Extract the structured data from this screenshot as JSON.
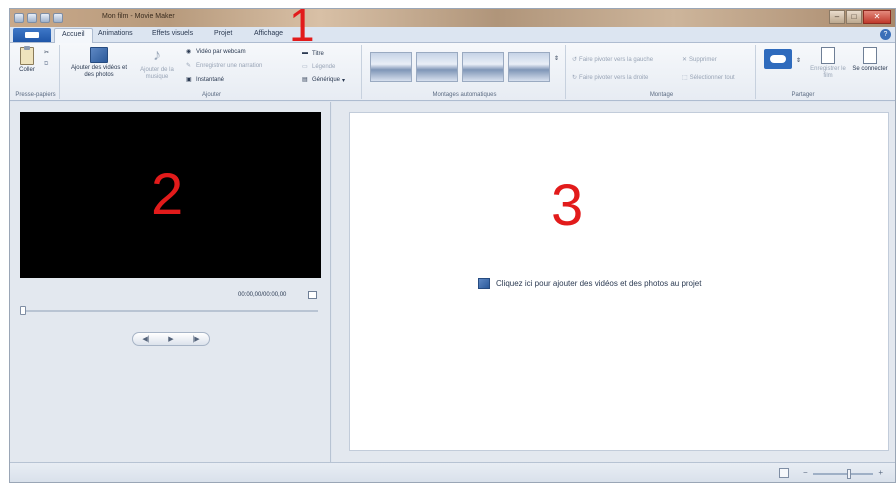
{
  "window": {
    "title": "Mon film - Movie Maker"
  },
  "tabs": [
    {
      "label": "Accueil",
      "active": true
    },
    {
      "label": "Animations"
    },
    {
      "label": "Effets visuels"
    },
    {
      "label": "Projet"
    },
    {
      "label": "Affichage"
    }
  ],
  "ribbon": {
    "clipboard": {
      "paste_label": "Coller",
      "group_label": "Presse-papiers"
    },
    "add": {
      "add_videos_label": "Ajouter des vidéos et des photos",
      "add_music_label": "Ajouter de la musique",
      "webcam_label": "Vidéo par webcam",
      "narration_label": "Enregistrer une narration",
      "snapshot_label": "Instantané",
      "title_label": "Titre",
      "caption_label": "Légende",
      "credits_label": "Générique",
      "group_label": "Ajouter"
    },
    "automovie": {
      "group_label": "Montages automatiques"
    },
    "editing": {
      "rotate_left_label": "Faire pivoter vers la gauche",
      "rotate_right_label": "Faire pivoter vers la droite",
      "delete_label": "Supprimer",
      "select_all_label": "Sélectionner tout",
      "group_label": "Montage"
    },
    "share": {
      "save_movie_label": "Enregistrer le film",
      "sign_in_label": "Se connecter",
      "group_label": "Partager"
    }
  },
  "preview": {
    "time": "00:00,00/00:00,00",
    "controls": [
      "◀|",
      "▶",
      "|▶"
    ]
  },
  "storyboard": {
    "hint": "Cliquez ici pour ajouter des vidéos et des photos au projet"
  },
  "markers": [
    "1",
    "2",
    "3"
  ]
}
